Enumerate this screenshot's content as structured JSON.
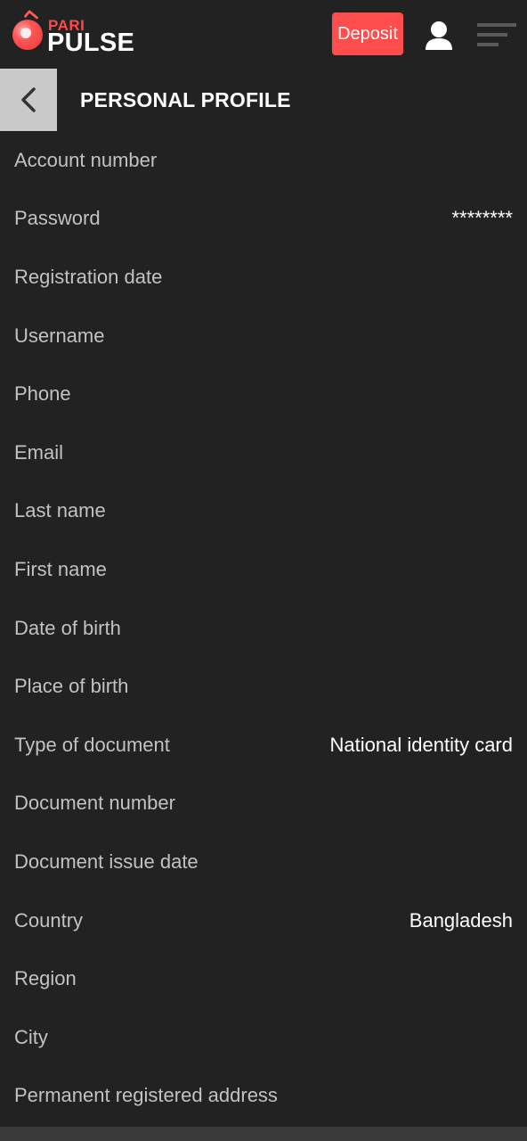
{
  "brand": {
    "top": "PARI",
    "bottom": "PULSE"
  },
  "header": {
    "deposit_label": "Deposit",
    "user_icon": "user-icon",
    "menu_icon": "hamburger-menu-icon"
  },
  "page": {
    "title": "PERSONAL PROFILE",
    "back_icon": "chevron-left-icon"
  },
  "fields": [
    {
      "label": "Account number",
      "value": ""
    },
    {
      "label": "Password",
      "value": "********"
    },
    {
      "label": "Registration date",
      "value": ""
    },
    {
      "label": "Username",
      "value": ""
    },
    {
      "label": "Phone",
      "value": ""
    },
    {
      "label": "Email",
      "value": ""
    },
    {
      "label": "Last name",
      "value": ""
    },
    {
      "label": "First name",
      "value": ""
    },
    {
      "label": "Date of birth",
      "value": ""
    },
    {
      "label": "Place of birth",
      "value": ""
    },
    {
      "label": "Type of document",
      "value": "National identity card"
    },
    {
      "label": "Document number",
      "value": ""
    },
    {
      "label": "Document issue date",
      "value": ""
    },
    {
      "label": "Country",
      "value": "Bangladesh"
    },
    {
      "label": "Region",
      "value": ""
    },
    {
      "label": "City",
      "value": ""
    },
    {
      "label": "Permanent registered address",
      "value": ""
    }
  ],
  "colors": {
    "background": "#222222",
    "accent": "#ff4c4c",
    "label": "#c2c2c2",
    "value": "#ffffff"
  }
}
